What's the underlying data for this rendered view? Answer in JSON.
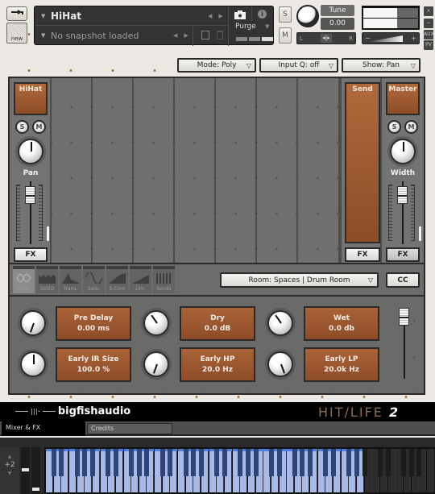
{
  "header": {
    "tool_icon": "wrench-icon",
    "new_label": "new",
    "instrument_name": "HiHat",
    "snapshot_text": "No snapshot loaded",
    "purge_label": "Purge",
    "solo_label": "S",
    "mute_label": "M",
    "tune_label": "Tune",
    "tune_value": "0.00",
    "pan_left": "L",
    "pan_right": "R",
    "volume_minus": "−",
    "volume_plus": "+",
    "side_buttons": [
      "×",
      "−",
      "AUX",
      "PV"
    ],
    "meter_levels": [
      0.62,
      0.62
    ]
  },
  "dropdowns": {
    "mode": "Mode: Poly",
    "input_q": "Input Q: off",
    "show": "Show: Pan"
  },
  "mixer": {
    "channel": {
      "name": "HiHat",
      "solo": "S",
      "mute": "M",
      "knob_label": "Pan",
      "fx_label": "FX"
    },
    "send": {
      "name": "Send",
      "fx_label": "FX"
    },
    "master": {
      "name": "Master",
      "solo": "S",
      "mute": "M",
      "knob_label": "Width",
      "fx_label": "FX"
    }
  },
  "fx_tabs": [
    {
      "label": "Conv.",
      "icon": "convolution-icon",
      "active": true
    },
    {
      "label": "SGEQ",
      "icon": "eq-icon",
      "active": false
    },
    {
      "label": "Trans.",
      "icon": "transient-icon",
      "active": false
    },
    {
      "label": "Satu.",
      "icon": "saturation-icon",
      "active": false
    },
    {
      "label": "S-Com",
      "icon": "compressor-icon",
      "active": false
    },
    {
      "label": "Lim.",
      "icon": "limiter-icon",
      "active": false
    },
    {
      "label": "Sends",
      "icon": "sends-icon",
      "active": false
    }
  ],
  "room": {
    "selector": "Room: Spaces | Drum Room",
    "cc_label": "CC"
  },
  "params": [
    {
      "name": "Pre Delay",
      "value": "0.00 ms"
    },
    {
      "name": "Dry",
      "value": "0.0 dB"
    },
    {
      "name": "Wet",
      "value": "0.0 db"
    },
    {
      "name": "Early IR Size",
      "value": "100.0 %"
    },
    {
      "name": "Early HP",
      "value": "20.0 Hz"
    },
    {
      "name": "Early LP",
      "value": "20.0k Hz"
    }
  ],
  "footer": {
    "brand": "bigfishaudio",
    "product": "HIT/LIFE",
    "product_version": "2",
    "tabs": [
      "Mixer & FX",
      "Credits"
    ]
  },
  "keyboard": {
    "octave_shift": "+2",
    "up_arrow": "▲",
    "down_arrow": "▼",
    "active_color": "#a9b9e8",
    "inactive_color": "#2c2c2c"
  },
  "colors": {
    "accent_brown": "#9a5630",
    "panel_gray": "#6c6c6a",
    "keyboard_blue": "#a9b9e8"
  }
}
